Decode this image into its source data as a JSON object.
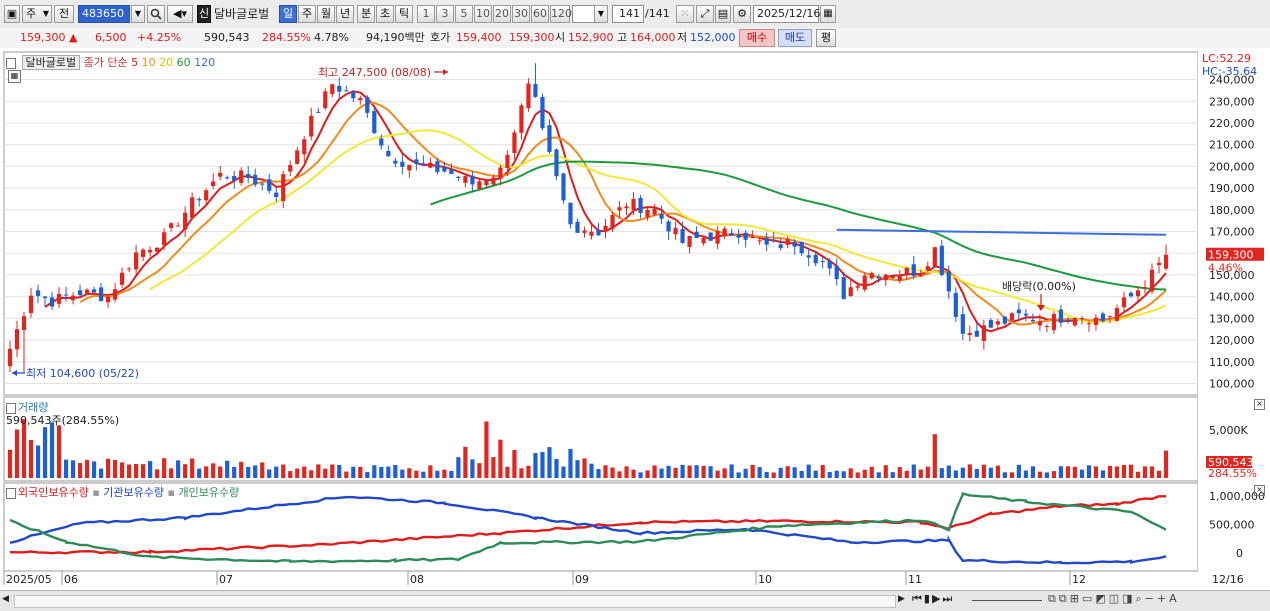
{
  "toolbar": {
    "period_select": "주",
    "prev_label": "전",
    "code": "483650",
    "new_badge": "신",
    "stock_name": "달바글로벌",
    "period_tabs": [
      "일",
      "주",
      "월",
      "년",
      "분",
      "초",
      "틱"
    ],
    "active_period": "일",
    "interval_buttons": [
      "1",
      "3",
      "5",
      "10",
      "20",
      "30",
      "60",
      "120"
    ],
    "count_display": "141",
    "count_total": "/141",
    "date_value": "2025/12/16"
  },
  "quote": {
    "price": "159,300",
    "change": "6,500",
    "change_pct": "+4.25%",
    "volume": "590,543",
    "volume_ratio": "284.55%",
    "turnover": "4.78%",
    "amount": "94,190백만",
    "ask_label": "호가",
    "ask": "159,400",
    "bid": "159,300",
    "open_label": "시",
    "open": "152,900",
    "high_label": "고",
    "high": "164,000",
    "low_label": "저",
    "low": "152,000",
    "buy_label": "매수",
    "sell_label": "매도",
    "eval_label": "평"
  },
  "price_panel": {
    "stock_tag": "달바글로벌",
    "legend_prefix": "종가 단순",
    "ma_periods": [
      "5",
      "10",
      "20",
      "60",
      "120"
    ],
    "ma_colors": [
      "#dd1c1c",
      "#f28a1c",
      "#f2e83a",
      "#1e9a3e",
      "#3c6ee0"
    ],
    "lc": "LC:52.29",
    "hc": "HC:-35.64",
    "high_note": "최고 247,500 (08/08)",
    "low_note": "최저 104,600 (05/22)",
    "dividend_note": "배당락(0.00%)",
    "last_price_tag": "159,300",
    "last_pct_tag": "4.46%"
  },
  "volume_panel": {
    "title": "거래량",
    "value_text": "590,543주(284.55%)",
    "axis_label": "5,000K",
    "last_tag": "590,543",
    "last_pct_tag": "284.55%"
  },
  "holdings_panel": {
    "series_names": [
      "외국인보유수량",
      "기관보유수량",
      "개인보유수량"
    ],
    "series_colors": [
      "#dd1c1c",
      "#1f49c8",
      "#2e8b57"
    ],
    "axis_labels": [
      "1,000,000",
      "500,000",
      "0"
    ]
  },
  "x_axis": {
    "labels": [
      "2025/05",
      "06",
      "07",
      "08",
      "09",
      "10",
      "11",
      "12"
    ],
    "end_label": "12/16"
  },
  "chart_data": {
    "type": "candlestick",
    "title": "",
    "y_ticks": [
      100000,
      110000,
      120000,
      130000,
      140000,
      150000,
      160000,
      170000,
      180000,
      190000,
      200000,
      210000,
      220000,
      230000,
      240000
    ],
    "ylim": [
      97000,
      249000
    ],
    "x_range": [
      "2025/05/16",
      "2025/12/16"
    ],
    "month_ticks": [
      "2025/05",
      "06",
      "07",
      "08",
      "09",
      "10",
      "11",
      "12"
    ],
    "period_high": {
      "value": 247500,
      "date": "08/08"
    },
    "period_low": {
      "value": 104600,
      "date": "05/22"
    },
    "last": {
      "close": 159300,
      "open": 152900,
      "high": 164000,
      "low": 152000,
      "volume": 590543
    },
    "close_path_anchors": [
      [
        0,
        116000
      ],
      [
        3,
        142000
      ],
      [
        6,
        138000
      ],
      [
        10,
        142000
      ],
      [
        14,
        140000
      ],
      [
        18,
        160000
      ],
      [
        22,
        167000
      ],
      [
        26,
        183000
      ],
      [
        30,
        196000
      ],
      [
        34,
        195000
      ],
      [
        38,
        188000
      ],
      [
        42,
        215000
      ],
      [
        46,
        238000
      ],
      [
        50,
        230000
      ],
      [
        54,
        205000
      ],
      [
        58,
        200000
      ],
      [
        62,
        198000
      ],
      [
        66,
        192000
      ],
      [
        70,
        198000
      ],
      [
        74,
        236000
      ],
      [
        76,
        215000
      ],
      [
        80,
        173000
      ],
      [
        84,
        170000
      ],
      [
        88,
        183000
      ],
      [
        92,
        180000
      ],
      [
        96,
        165000
      ],
      [
        100,
        168000
      ],
      [
        104,
        170000
      ],
      [
        108,
        163000
      ],
      [
        112,
        165000
      ],
      [
        116,
        156000
      ],
      [
        119,
        141000
      ],
      [
        122,
        151000
      ],
      [
        126,
        151000
      ],
      [
        130,
        152000
      ],
      [
        132,
        162000
      ],
      [
        134,
        143000
      ],
      [
        136,
        123000
      ],
      [
        140,
        126000
      ],
      [
        144,
        131000
      ],
      [
        148,
        129000
      ],
      [
        152,
        132000
      ],
      [
        156,
        129000
      ],
      [
        160,
        140000
      ],
      [
        163,
        150000
      ],
      [
        165,
        159300
      ]
    ],
    "volume_unit": "주",
    "holdings_series": [
      {
        "name": "외국인보유수량"
      },
      {
        "name": "기관보유수량"
      },
      {
        "name": "개인보유수량"
      }
    ]
  }
}
